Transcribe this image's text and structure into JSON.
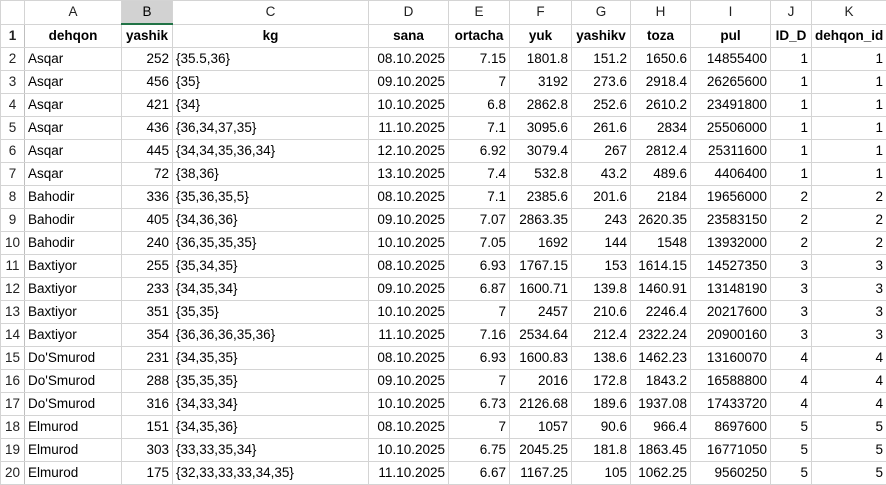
{
  "columns": [
    "A",
    "B",
    "C",
    "D",
    "E",
    "F",
    "G",
    "H",
    "I",
    "J",
    "K"
  ],
  "selected_column": "B",
  "headers": [
    "dehqon",
    "yashik",
    "kg",
    "sana",
    "ortacha",
    "yuk",
    "yashikv",
    "toza",
    "pul",
    "ID_D",
    "dehqon_id"
  ],
  "rows": [
    [
      "Asqar",
      "252",
      "{35.5,36}",
      "08.10.2025",
      "7.15",
      "1801.8",
      "151.2",
      "1650.6",
      "14855400",
      "1",
      "1"
    ],
    [
      "Asqar",
      "456",
      "{35}",
      "09.10.2025",
      "7",
      "3192",
      "273.6",
      "2918.4",
      "26265600",
      "1",
      "1"
    ],
    [
      "Asqar",
      "421",
      "{34}",
      "10.10.2025",
      "6.8",
      "2862.8",
      "252.6",
      "2610.2",
      "23491800",
      "1",
      "1"
    ],
    [
      "Asqar",
      "436",
      "{36,34,37,35}",
      "11.10.2025",
      "7.1",
      "3095.6",
      "261.6",
      "2834",
      "25506000",
      "1",
      "1"
    ],
    [
      "Asqar",
      "445",
      "{34,34,35,36,34}",
      "12.10.2025",
      "6.92",
      "3079.4",
      "267",
      "2812.4",
      "25311600",
      "1",
      "1"
    ],
    [
      "Asqar",
      "72",
      "{38,36}",
      "13.10.2025",
      "7.4",
      "532.8",
      "43.2",
      "489.6",
      "4406400",
      "1",
      "1"
    ],
    [
      "Bahodir",
      "336",
      "{35,36,35,5}",
      "08.10.2025",
      "7.1",
      "2385.6",
      "201.6",
      "2184",
      "19656000",
      "2",
      "2"
    ],
    [
      "Bahodir",
      "405",
      "{34,36,36}",
      "09.10.2025",
      "7.07",
      "2863.35",
      "243",
      "2620.35",
      "23583150",
      "2",
      "2"
    ],
    [
      "Bahodir",
      "240",
      "{36,35,35,35}",
      "10.10.2025",
      "7.05",
      "1692",
      "144",
      "1548",
      "13932000",
      "2",
      "2"
    ],
    [
      "Baxtiyor",
      "255",
      "{35,34,35}",
      "08.10.2025",
      "6.93",
      "1767.15",
      "153",
      "1614.15",
      "14527350",
      "3",
      "3"
    ],
    [
      "Baxtiyor",
      "233",
      "{34,35,34}",
      "09.10.2025",
      "6.87",
      "1600.71",
      "139.8",
      "1460.91",
      "13148190",
      "3",
      "3"
    ],
    [
      "Baxtiyor",
      "351",
      "{35,35}",
      "10.10.2025",
      "7",
      "2457",
      "210.6",
      "2246.4",
      "20217600",
      "3",
      "3"
    ],
    [
      "Baxtiyor",
      "354",
      "{36,36,36,35,36}",
      "11.10.2025",
      "7.16",
      "2534.64",
      "212.4",
      "2322.24",
      "20900160",
      "3",
      "3"
    ],
    [
      "Do'Smurod",
      "231",
      "{34,35,35}",
      "08.10.2025",
      "6.93",
      "1600.83",
      "138.6",
      "1462.23",
      "13160070",
      "4",
      "4"
    ],
    [
      "Do'Smurod",
      "288",
      "{35,35,35}",
      "09.10.2025",
      "7",
      "2016",
      "172.8",
      "1843.2",
      "16588800",
      "4",
      "4"
    ],
    [
      "Do'Smurod",
      "316",
      "{34,33,34}",
      "10.10.2025",
      "6.73",
      "2126.68",
      "189.6",
      "1937.08",
      "17433720",
      "4",
      "4"
    ],
    [
      "Elmurod",
      "151",
      "{34,35,36}",
      "08.10.2025",
      "7",
      "1057",
      "90.6",
      "966.4",
      "8697600",
      "5",
      "5"
    ],
    [
      "Elmurod",
      "303",
      "{33,33,35,34}",
      "10.10.2025",
      "6.75",
      "2045.25",
      "181.8",
      "1863.45",
      "16771050",
      "5",
      "5"
    ],
    [
      "Elmurod",
      "175",
      "{32,33,33,33,34,35}",
      "11.10.2025",
      "6.67",
      "1167.25",
      "105",
      "1062.25",
      "9560250",
      "5",
      "5"
    ]
  ]
}
